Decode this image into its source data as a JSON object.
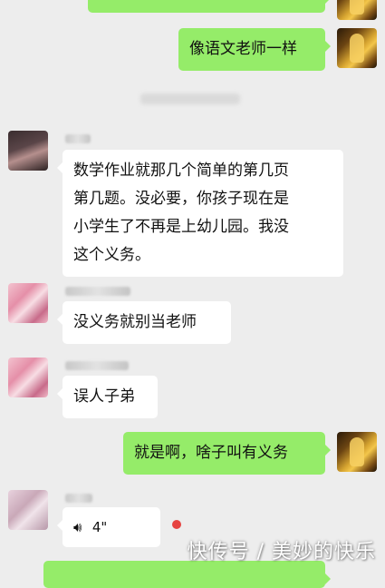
{
  "chat": {
    "messages": [
      {
        "side": "right",
        "text": "像语文老师一样"
      },
      {
        "side": "left",
        "lines": [
          "数学作业就那几个简单的第几页",
          "第几题。没必要，你孩子现在是",
          "小学生了不再是上幼儿园。我没",
          "这个义务。"
        ]
      },
      {
        "side": "left",
        "text": "没义务就别当老师"
      },
      {
        "side": "left",
        "text": "误人子弟"
      },
      {
        "side": "right",
        "text": "就是啊，啥子叫有义务"
      },
      {
        "side": "left",
        "type": "voice",
        "duration": "4\""
      }
    ]
  },
  "voice_icon": "voice-wave-icon",
  "watermark": {
    "text": "快传号 / 美妙的快乐"
  },
  "colors": {
    "background": "#ededed",
    "left_bubble": "#ffffff",
    "right_bubble": "#95ec69",
    "unread_dot": "#e64340"
  }
}
